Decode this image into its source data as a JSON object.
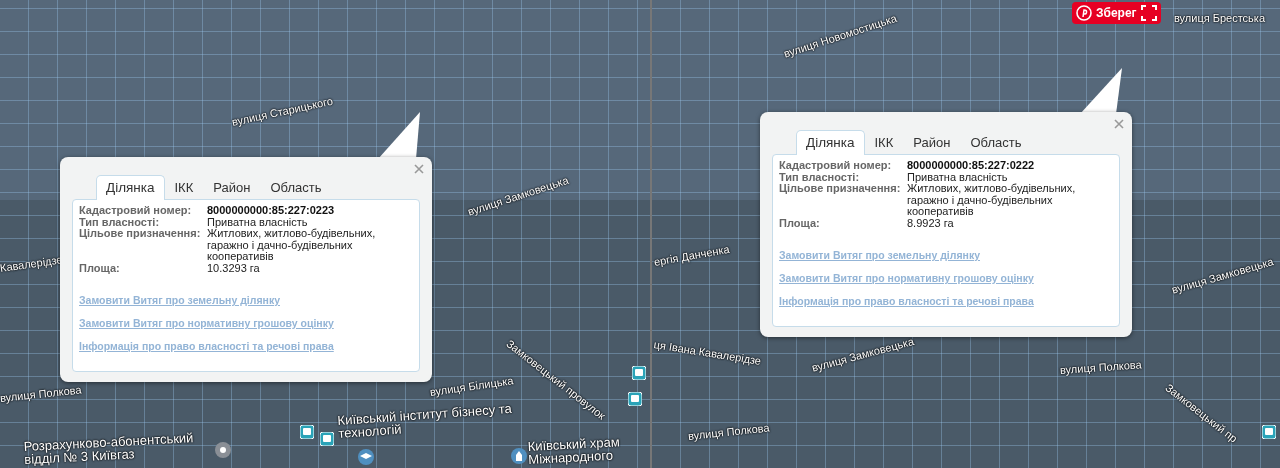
{
  "panels": [
    {
      "map": {
        "labels": [
          {
            "text": "вулиця Старицького"
          },
          {
            "text": "вулиця Замковецька"
          },
          {
            "text": "Кавалерідзе"
          },
          {
            "text": "Замковецький провулок"
          },
          {
            "text": "вулиця Полкова"
          },
          {
            "text": "вулиця Білицька"
          },
          {
            "text": "Київський інститут бізнесу та технологій"
          },
          {
            "text": "Розрахунково-абонентський відділ № 3 Київгаз"
          },
          {
            "text": "Київський храм Міжнародного"
          }
        ]
      },
      "popup": {
        "tabs": [
          {
            "label": "Ділянка",
            "selected": true
          },
          {
            "label": "ІКК",
            "selected": false
          },
          {
            "label": "Район",
            "selected": false
          },
          {
            "label": "Область",
            "selected": false
          }
        ],
        "fields": [
          {
            "label": "Кадастровий номер:",
            "value": "8000000000:85:227:0223",
            "kind": "id"
          },
          {
            "label": "Тип власності:",
            "value": "Приватна власність",
            "kind": "text"
          },
          {
            "label": "Цільове призначення:",
            "value": "Житлових, житлово-будівельних, гаражно і дачно-будівельних кооперативів",
            "kind": "text"
          },
          {
            "label": "Площа:",
            "value": "10.3293 га",
            "kind": "text"
          }
        ],
        "links": [
          "Замовити Витяг про земельну ділянку",
          "Замовити Витяг про нормативну грошову оцінку",
          "Інформація про право власності та речові права"
        ]
      }
    },
    {
      "map": {
        "labels": [
          {
            "text": "вулиця Новомостицька"
          },
          {
            "text": "вулиця Брестська"
          },
          {
            "text": "ергія Данченка"
          },
          {
            "text": "ця Івана Кавалерідзе"
          },
          {
            "text": "вулиця Замковецька"
          },
          {
            "text": "вулиця Полкова"
          },
          {
            "text": "вулиця Полкова"
          },
          {
            "text": "вулиця Замковецька"
          },
          {
            "text": "Замковецький пр"
          }
        ]
      },
      "save_button": {
        "label": "Зберег"
      },
      "popup": {
        "tabs": [
          {
            "label": "Ділянка",
            "selected": true
          },
          {
            "label": "ІКК",
            "selected": false
          },
          {
            "label": "Район",
            "selected": false
          },
          {
            "label": "Область",
            "selected": false
          }
        ],
        "fields": [
          {
            "label": "Кадастровий номер:",
            "value": "8000000000:85:227:0222",
            "kind": "id"
          },
          {
            "label": "Тип власності:",
            "value": "Приватна власність",
            "kind": "text"
          },
          {
            "label": "Цільове призначення:",
            "value": "Житлових, житлово-будівельних, гаражно і дачно-будівельних кооперативів",
            "kind": "text"
          },
          {
            "label": "Площа:",
            "value": "8.9923 га",
            "kind": "text"
          }
        ],
        "links": [
          "Замовити Витяг про земельну ділянку",
          "Замовити Витяг про нормативну грошову оцінку",
          "Інформація про право власності та речові права"
        ]
      }
    }
  ]
}
